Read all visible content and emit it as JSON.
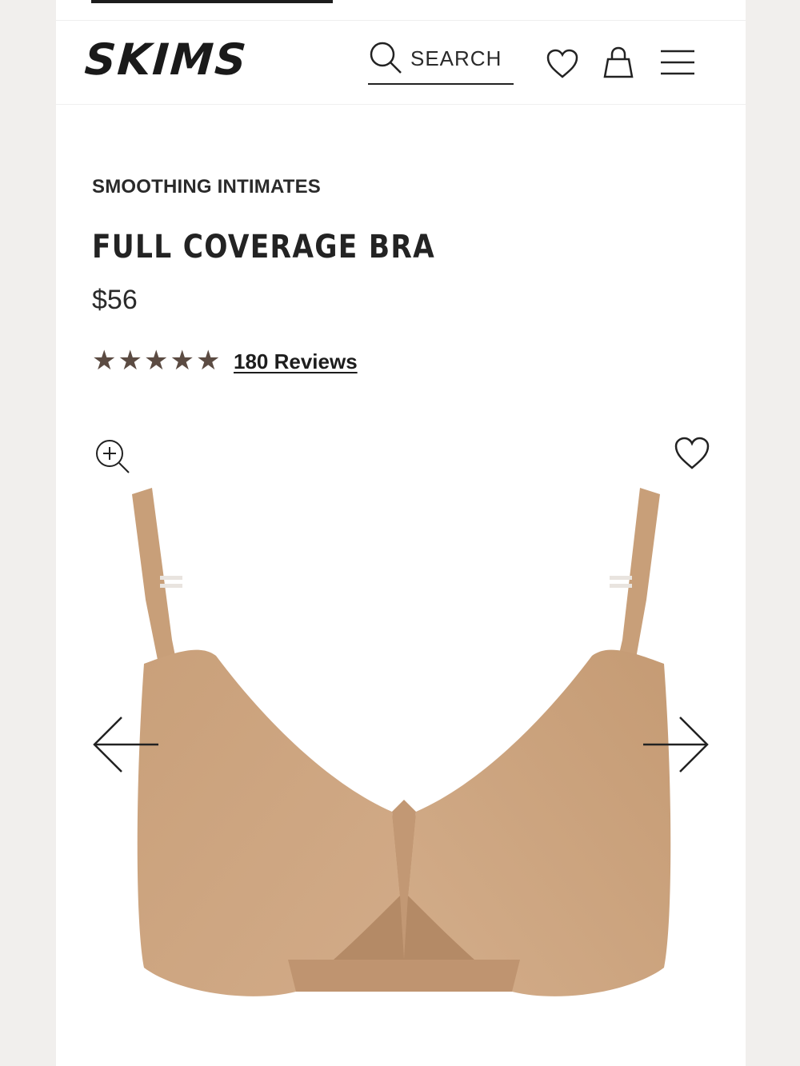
{
  "header": {
    "brand": "SKIMS",
    "search_label": "SEARCH"
  },
  "product": {
    "category": "SMOOTHING INTIMATES",
    "name": "FULL COVERAGE BRA",
    "price": "$56",
    "rating": 5,
    "reviews_label": "180 Reviews",
    "color": "#caa27d"
  },
  "icons": {
    "search": "search-icon",
    "wishlist": "heart-icon",
    "bag": "shopping-bag-icon",
    "menu": "hamburger-menu-icon",
    "zoom": "zoom-in-icon",
    "prev": "arrow-left-icon",
    "next": "arrow-right-icon"
  }
}
